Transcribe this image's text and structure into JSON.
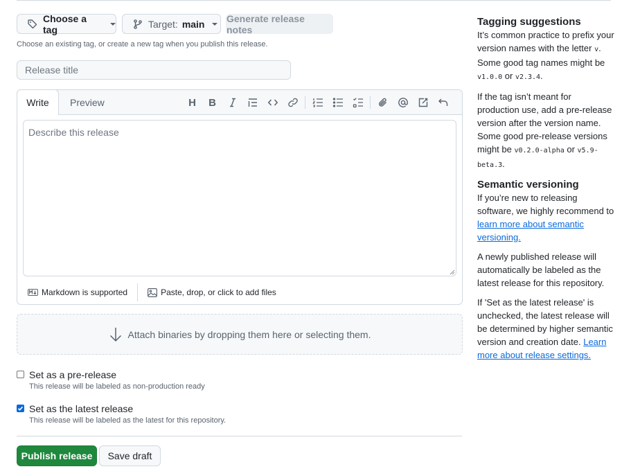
{
  "top": {
    "tag_label": "Choose a tag",
    "target_label": "Target:",
    "target_value": "main",
    "generate_label": "Generate release notes",
    "hint": "Choose an existing tag, or create a new tag when you publish this release."
  },
  "title_input": {
    "placeholder": "Release title",
    "value": ""
  },
  "editor": {
    "tab_write": "Write",
    "tab_preview": "Preview",
    "toolbar_icons": [
      "heading-icon",
      "bold-icon",
      "italic-icon",
      "quote-icon",
      "code-icon",
      "link-icon",
      "ordered-list-icon",
      "unordered-list-icon",
      "task-list-icon",
      "attachment-icon",
      "mention-icon",
      "reference-icon",
      "undo-icon"
    ],
    "placeholder": "Describe this release",
    "markdown_label": "Markdown is supported",
    "files_label": "Paste, drop, or click to add files"
  },
  "dropzone": {
    "label": "Attach binaries by dropping them here or selecting them."
  },
  "prerelease": {
    "label": "Set as a pre-release",
    "sub": "This release will be labeled as non-production ready",
    "checked": false
  },
  "latest": {
    "label": "Set as the latest release",
    "sub": "This release will be labeled as the latest for this repository.",
    "checked": true
  },
  "actions": {
    "publish": "Publish release",
    "draft": "Save draft"
  },
  "sidebar": {
    "h1": "Tagging suggestions",
    "p1a": "It’s common practice to prefix your version names with the letter ",
    "p1v": "v",
    "p1b": ". Some good tag names might be ",
    "p1c1": "v1.0.0",
    "p1or": " or ",
    "p1c2": "v2.3.4",
    "p1end": ".",
    "p2a": "If the tag isn’t meant for production use, add a pre-release version after the version name. Some good pre-release versions might be ",
    "p2c1": "v0.2.0-alpha",
    "p2or": " or ",
    "p2c2": "v5.9-beta.3",
    "p2end": ".",
    "h2": "Semantic versioning",
    "p3a": "If you’re new to releasing software, we highly recommend to ",
    "p3link": "learn more about semantic versioning.",
    "p4": "A newly published release will automatically be labeled as the latest release for this repository.",
    "p5a": "If 'Set as the latest release' is unchecked, the latest release will be determined by higher semantic version and creation date. ",
    "p5link": "Learn more about release settings."
  },
  "colors": {
    "primary": "#1f883d",
    "link": "#0969da",
    "border": "#d1d9e0",
    "muted": "#59636e"
  }
}
